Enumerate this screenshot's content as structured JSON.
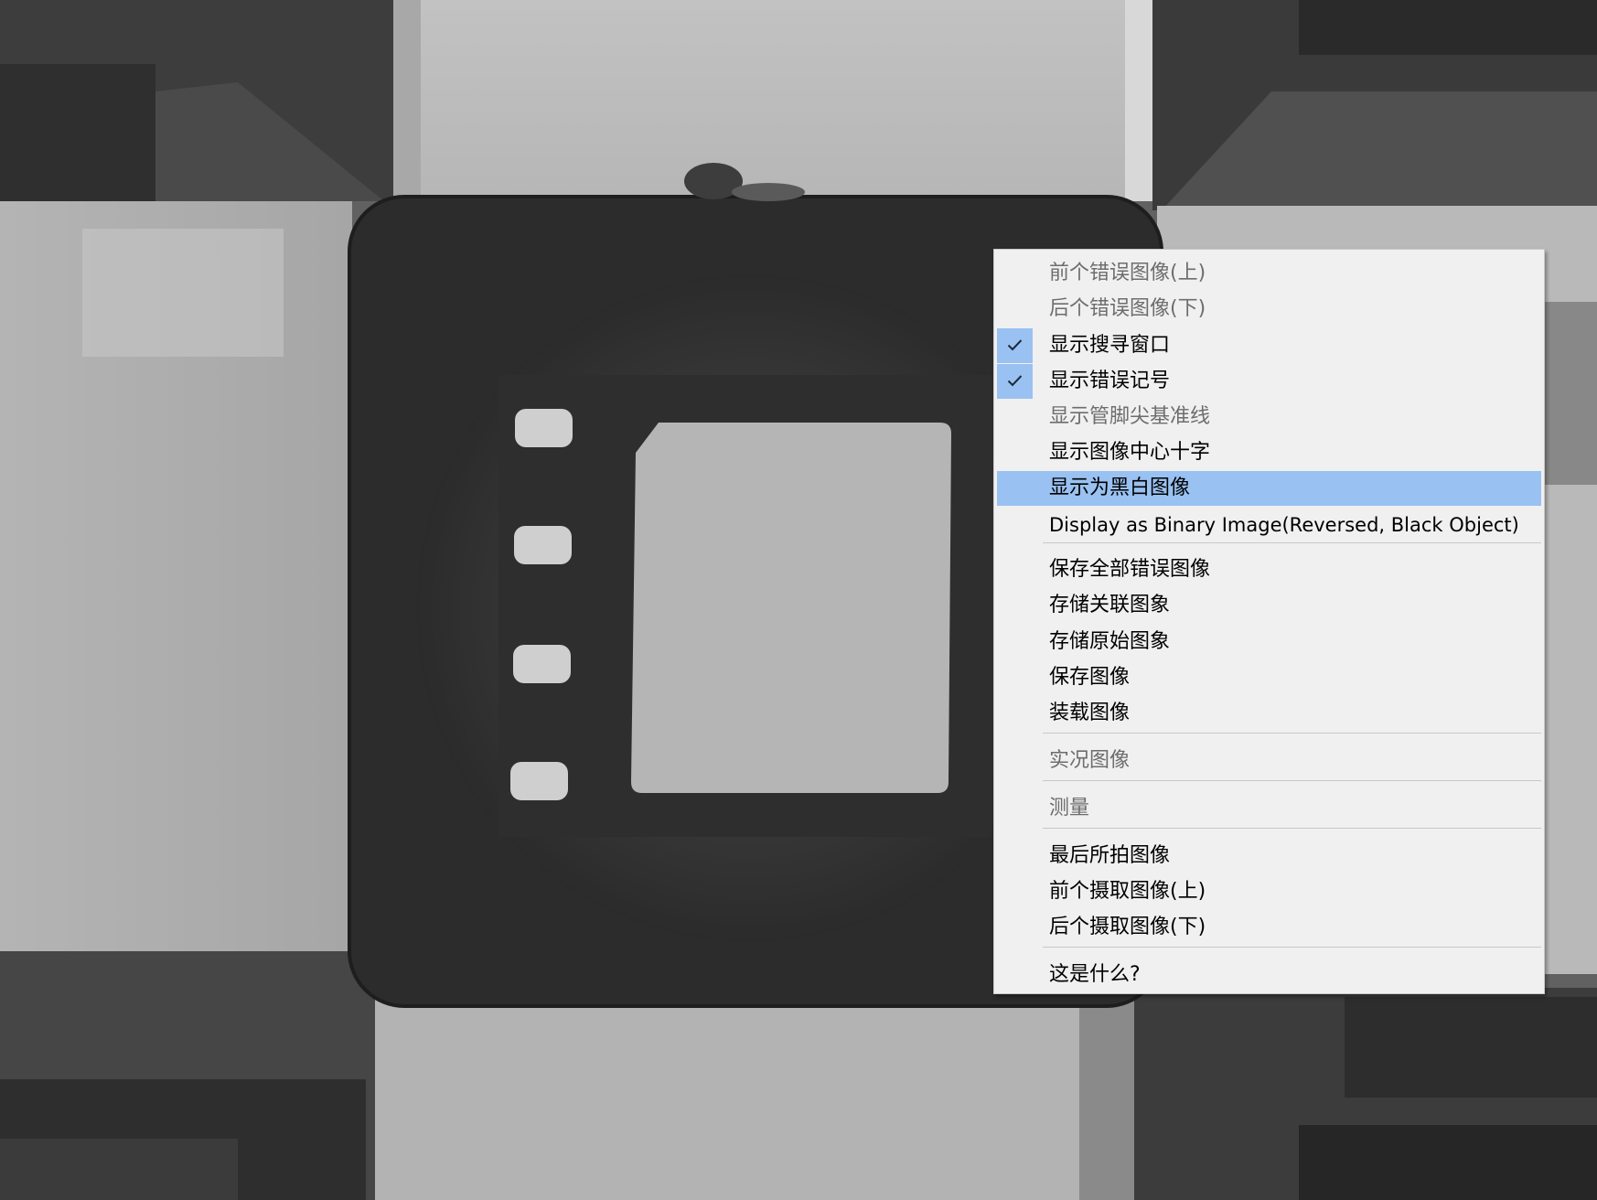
{
  "menu": {
    "items": [
      {
        "label": "前个错误图像(上)",
        "disabled": true
      },
      {
        "label": "后个错误图像(下)",
        "disabled": true
      },
      {
        "label": "显示搜寻窗口",
        "checked": true
      },
      {
        "label": "显示错误记号",
        "checked": true
      },
      {
        "label": "显示管脚尖基准线",
        "disabled": true
      },
      {
        "label": "显示图像中心十字"
      },
      {
        "label": "显示为黑白图像",
        "highlighted": true
      },
      {
        "label": "Display as Binary Image(Reversed, Black Object)"
      },
      {
        "label": "保存全部错误图像"
      },
      {
        "label": "存储关联图象"
      },
      {
        "label": "存储原始图象"
      },
      {
        "label": "保存图像"
      },
      {
        "label": "装载图像"
      },
      {
        "label": "实况图像",
        "disabled": true
      },
      {
        "label": "测量",
        "disabled": true
      },
      {
        "label": "最后所拍图像"
      },
      {
        "label": "前个摄取图像(上)"
      },
      {
        "label": "后个摄取图像(下)"
      },
      {
        "label": "这是什么?"
      }
    ]
  },
  "colors": {
    "menu_background": "#f0f0f0",
    "highlight": "#99c1f1",
    "disabled_text": "#6d6d6d"
  },
  "icons": {
    "check": "check-icon"
  }
}
